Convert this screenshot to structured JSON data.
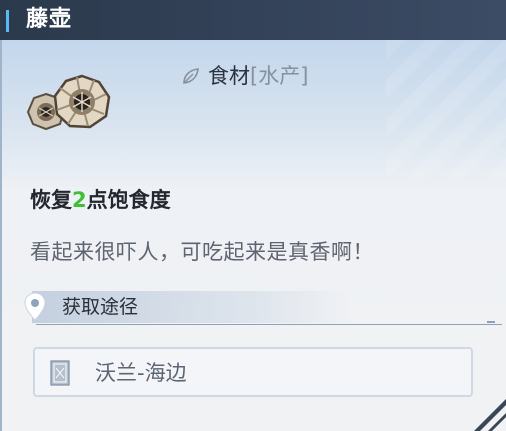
{
  "header": {
    "title": "藤壶"
  },
  "item": {
    "icon": "barnacle-icon",
    "category": "食材",
    "category_sub": "[水产]",
    "effect_prefix": "恢复",
    "effect_value": "2",
    "effect_suffix": "点饱食度",
    "description": "看起来很吓人，可吃起来是真香啊！"
  },
  "source": {
    "label": "获取途径",
    "location": "沃兰-海边"
  },
  "colors": {
    "header_bg": "#2f3d52",
    "accent_bar": "#5ab8f5",
    "effect_value": "#3fbf34"
  }
}
